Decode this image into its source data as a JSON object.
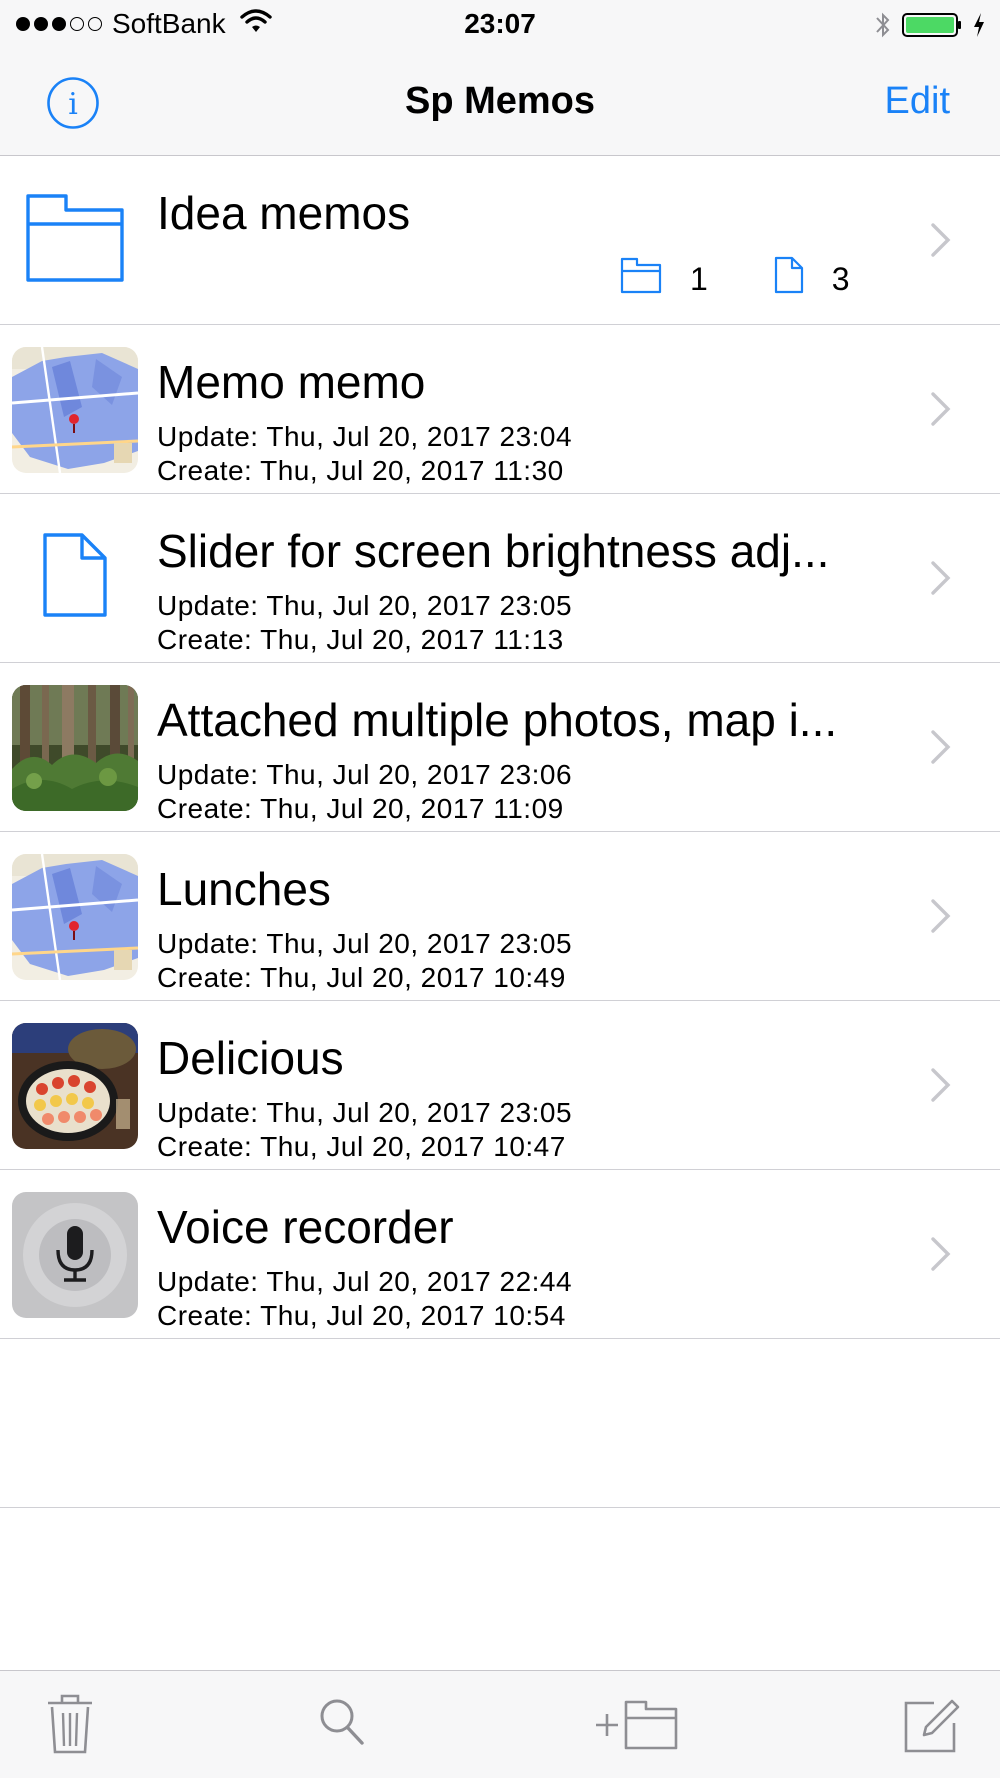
{
  "status_bar": {
    "carrier": "SoftBank",
    "time": "23:07",
    "signal_filled": 3,
    "signal_total": 5,
    "battery_level": 1.0,
    "battery_color": "#4cd964",
    "icons": [
      "wifi-icon",
      "bluetooth-icon",
      "battery-icon",
      "charging-bolt-icon"
    ]
  },
  "nav_bar": {
    "title": "Sp Memos",
    "edit_label": "Edit",
    "accent_color": "#1a82f7",
    "info_icon": "info-icon"
  },
  "folder": {
    "title": "Idea memos",
    "folder_count": "1",
    "file_count": "3",
    "icon": "folder-icon"
  },
  "memos": [
    {
      "title": "Memo memo",
      "update": "Update: Thu, Jul 20, 2017 23:04",
      "create": "Create: Thu, Jul 20, 2017 11:30",
      "thumbnail": "map-thumbnail"
    },
    {
      "title": "Slider for screen brightness adj...",
      "update": "Update: Thu, Jul 20, 2017 23:05",
      "create": "Create: Thu, Jul 20, 2017 11:13",
      "thumbnail": "document-icon"
    },
    {
      "title": "Attached multiple photos, map i...",
      "update": "Update: Thu, Jul 20, 2017 23:06",
      "create": "Create: Thu, Jul 20, 2017 11:09",
      "thumbnail": "forest-photo-thumbnail"
    },
    {
      "title": "Lunches",
      "update": "Update: Thu, Jul 20, 2017 23:05",
      "create": "Create: Thu, Jul 20, 2017 10:49",
      "thumbnail": "map-thumbnail"
    },
    {
      "title": "Delicious",
      "update": "Update: Thu, Jul 20, 2017 23:05",
      "create": "Create: Thu, Jul 20, 2017 10:47",
      "thumbnail": "sushi-photo-thumbnail"
    },
    {
      "title": "Voice recorder",
      "update": "Update: Thu, Jul 20, 2017 22:44",
      "create": "Create: Thu, Jul 20, 2017 10:54",
      "thumbnail": "microphone-thumbnail"
    }
  ],
  "toolbar": {
    "buttons": [
      "trash-icon",
      "search-icon",
      "new-folder-icon",
      "compose-icon"
    ]
  }
}
